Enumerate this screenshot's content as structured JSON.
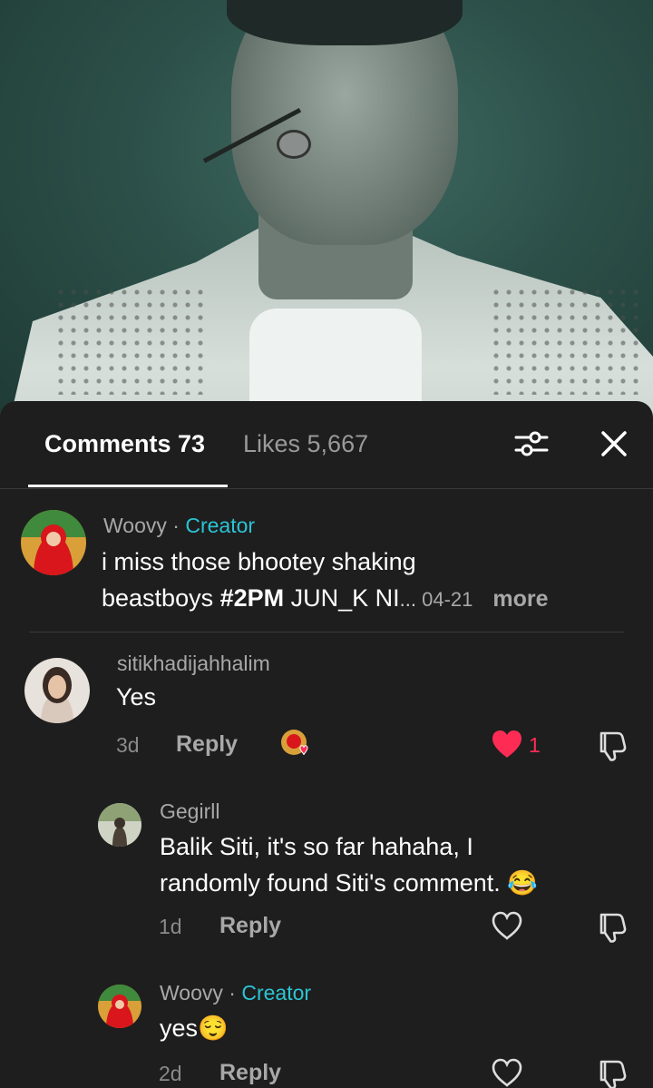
{
  "tabs": {
    "comments_label": "Comments 73",
    "likes_label": "Likes 5,667"
  },
  "comments": [
    {
      "username": "Woovy",
      "separator": " · ",
      "badge": "Creator",
      "line1": "i miss those bhootey shaking",
      "line2_prefix": "beastboys  ",
      "hashtag": "#2PM",
      "line2_suffix": " JUN_K NI",
      "ellipsis": "... ",
      "date": "04-21",
      "more_label": "more"
    },
    {
      "username": "sitikhadijahhalim",
      "text": "Yes",
      "time": "3d",
      "reply_label": "Reply",
      "like_count": "1",
      "liked": true,
      "replies": [
        {
          "username": "Gegirll",
          "line1": "Balik Siti, it's so far hahaha, I",
          "line2": "randomly found Siti's comment. 😂",
          "time": "1d",
          "reply_label": "Reply"
        },
        {
          "username": "Woovy",
          "separator": " · ",
          "badge": "Creator",
          "text": "yes😌",
          "time": "2d",
          "reply_label": "Reply"
        }
      ]
    }
  ],
  "colors": {
    "accent_creator": "#2bc4d4",
    "like_red": "#fe2c55",
    "background": "#1e1e1e"
  },
  "icons": [
    "filter-icon",
    "close-icon",
    "heart-icon",
    "dislike-icon"
  ]
}
